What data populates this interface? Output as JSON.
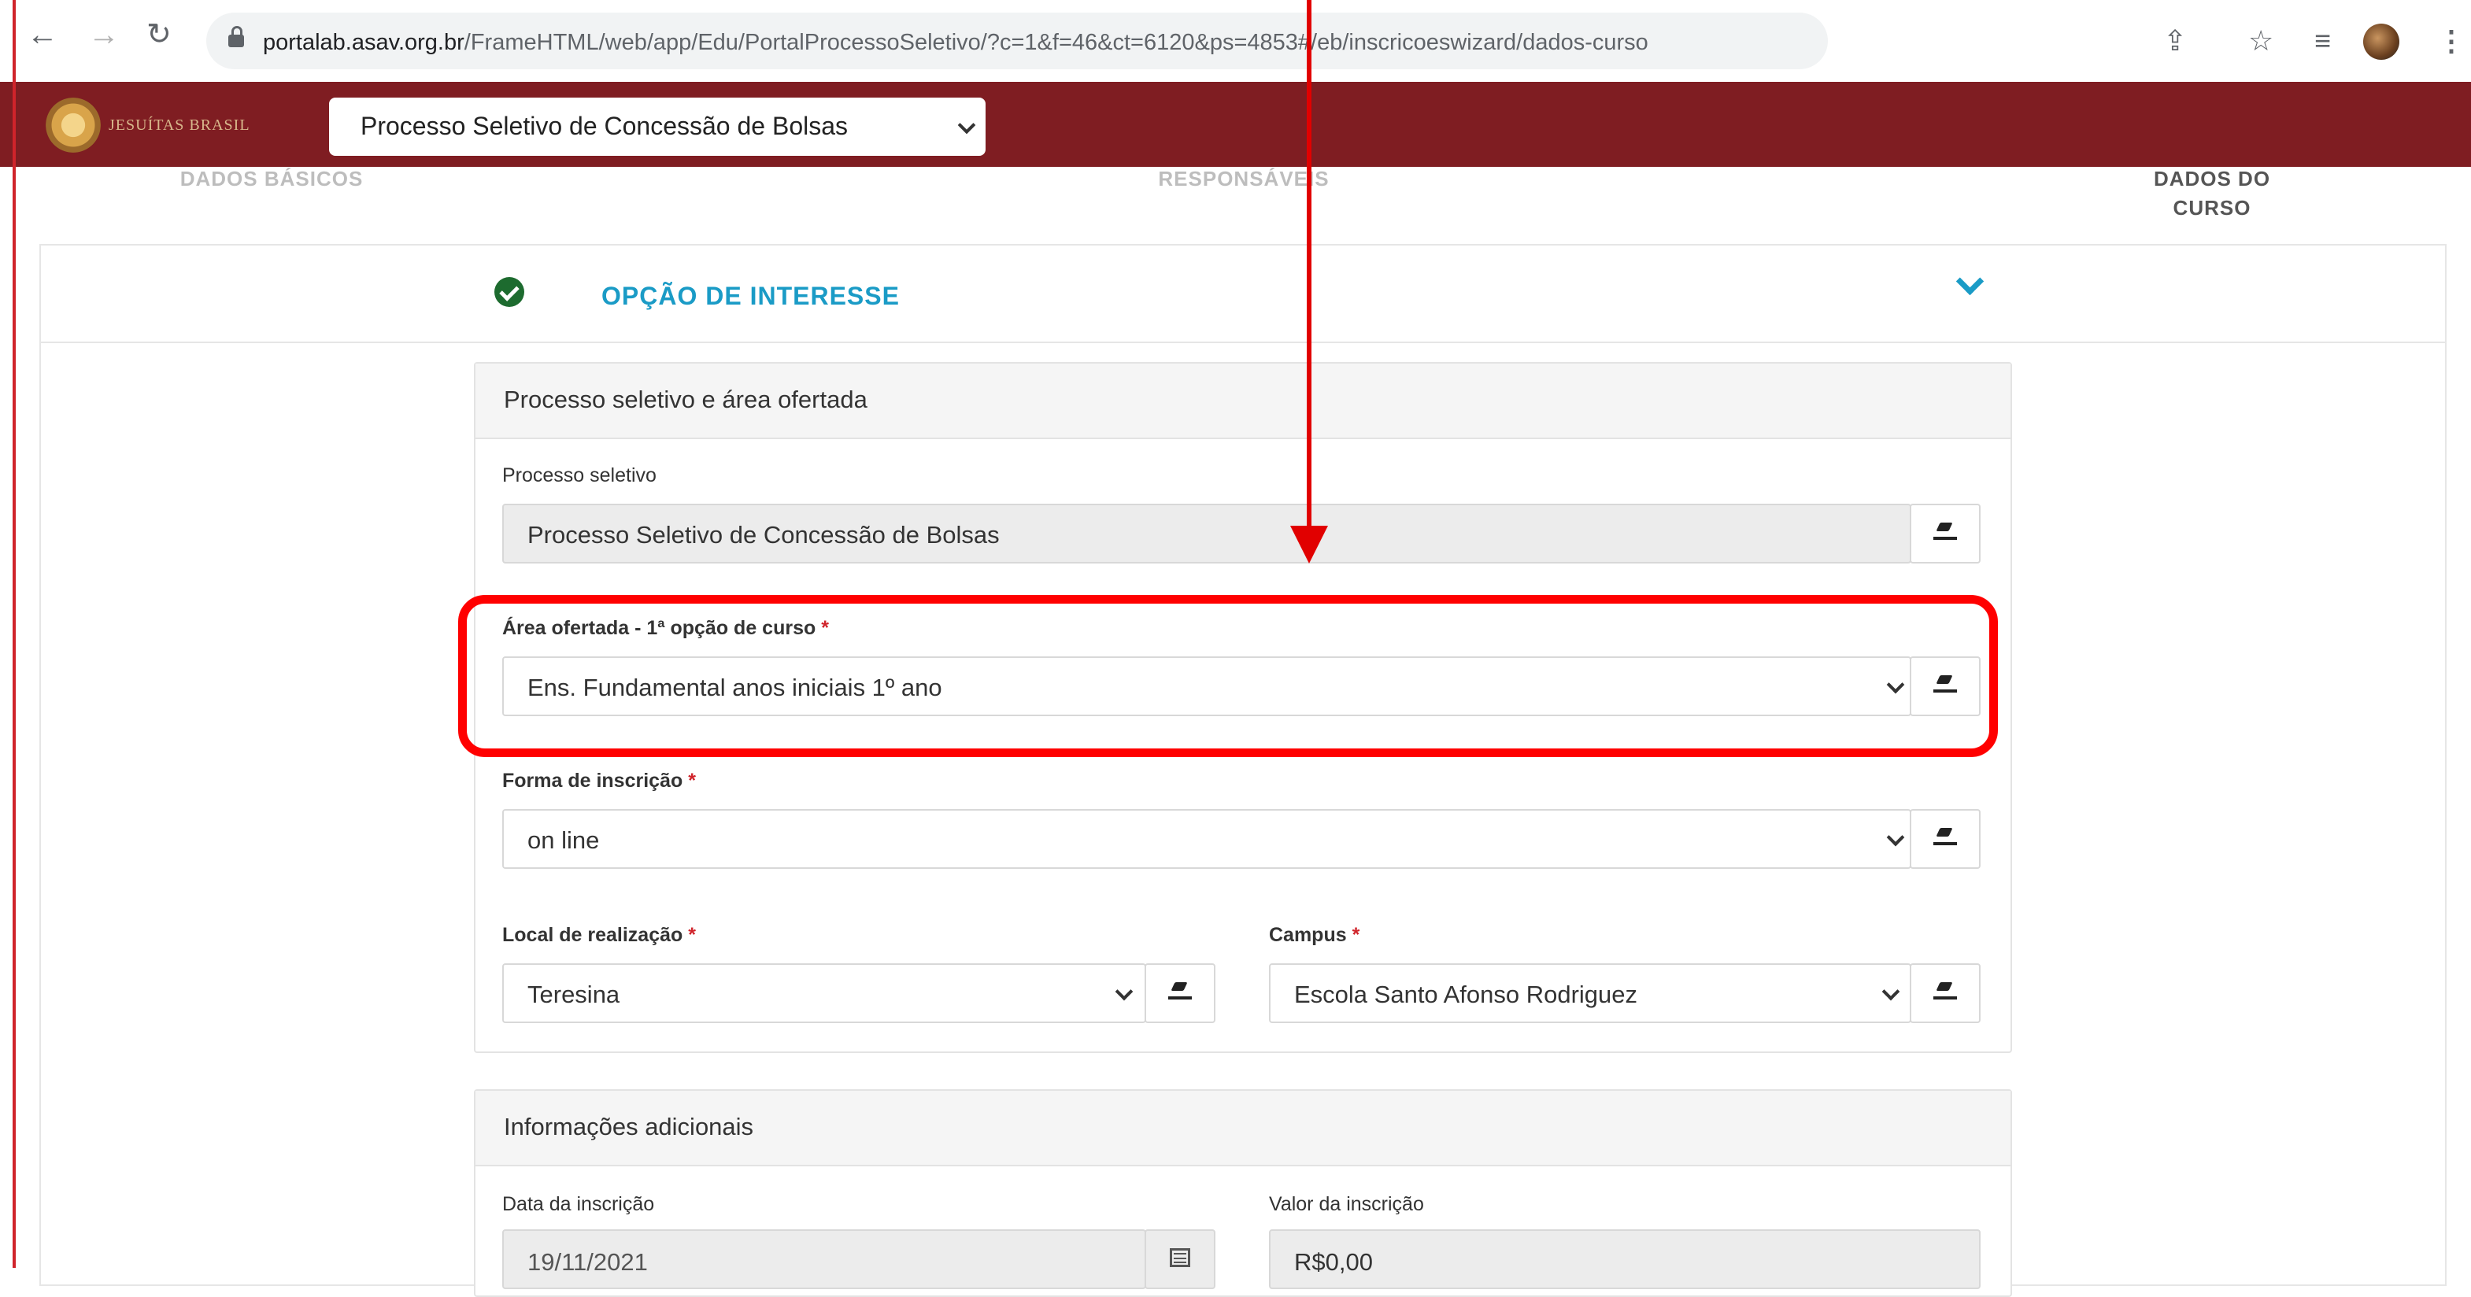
{
  "browser": {
    "url_host": "portalab.asav.org.br",
    "url_path": "/FrameHTML/web/app/Edu/PortalProcessoSeletivo/?c=1&f=46&ct=6120&ps=4853#/eb/inscricoeswizard/dados-curso"
  },
  "app": {
    "logo_text": "JESUÍTAS BRASIL",
    "process_select": "Processo Seletivo de Concessão de Bolsas"
  },
  "wizard": {
    "steps": [
      {
        "label": "DADOS BÁSICOS",
        "state": "done"
      },
      {
        "label": "RESPONSÁVEIS",
        "state": "done"
      },
      {
        "label_line1": "DADOS DO",
        "label_line2": "CURSO",
        "state": "active"
      }
    ]
  },
  "accordion": {
    "title": "OPÇÃO DE INTERESSE",
    "status": "complete"
  },
  "section1": {
    "title": "Processo seletivo e área ofertada",
    "processo_label": "Processo seletivo",
    "processo_value": "Processo Seletivo de Concessão de Bolsas",
    "area_label": "Área ofertada - 1ª opção de curso",
    "area_value": "Ens. Fundamental anos iniciais 1º ano",
    "forma_label": "Forma de inscrição",
    "forma_value": "on line",
    "local_label": "Local de realização",
    "local_value": "Teresina",
    "campus_label": "Campus",
    "campus_value": "Escola Santo Afonso Rodriguez",
    "required_mark": "*"
  },
  "section2": {
    "title": "Informações adicionais",
    "data_label": "Data da inscrição",
    "data_value": "19/11/2021",
    "valor_label": "Valor da inscrição",
    "valor_value": "R$0,00"
  },
  "annotation": {
    "color": "#ff0000"
  },
  "colors": {
    "brand": "#7f1d22",
    "accent": "#1a9bc6",
    "success": "#1d6b2f"
  }
}
